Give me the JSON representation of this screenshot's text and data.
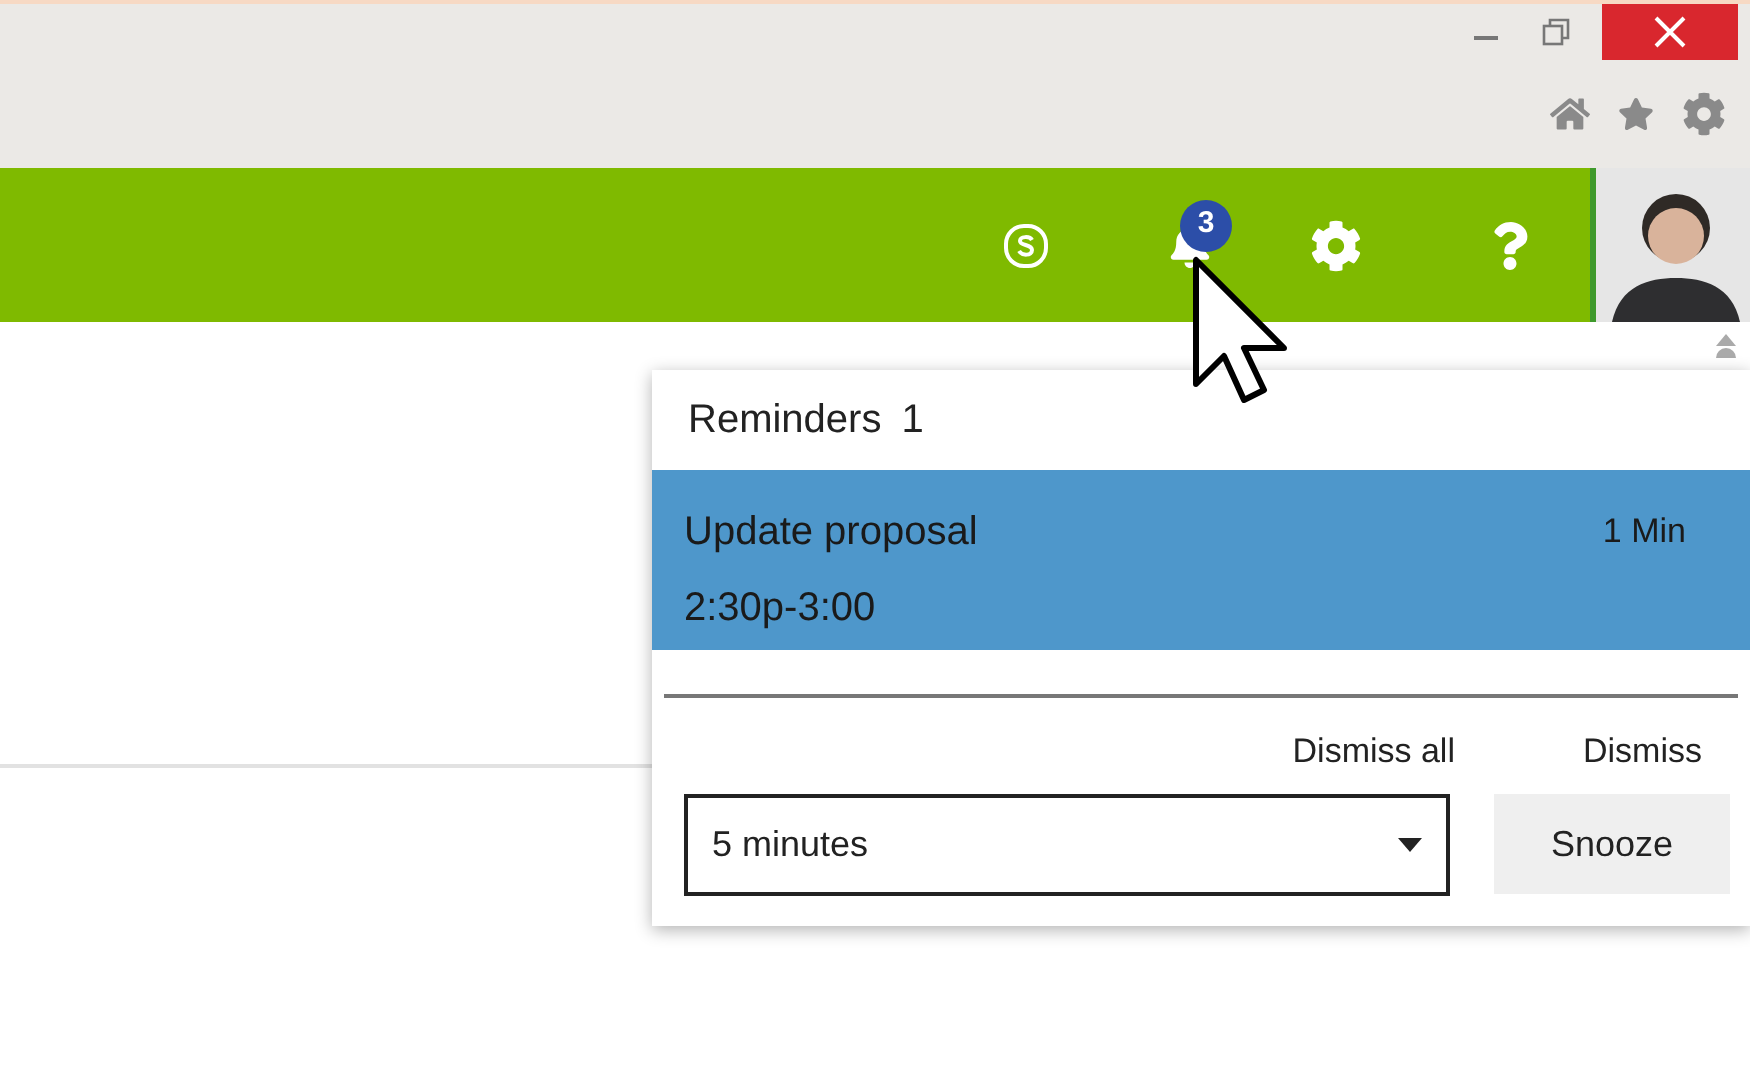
{
  "notifications": {
    "count": "3"
  },
  "reminders": {
    "title": "Reminders",
    "count": "1",
    "items": [
      {
        "title": "Update proposal",
        "time": "2:30p-3:00",
        "due": "1 Min",
        "selected": true
      }
    ],
    "dismiss_all": "Dismiss all",
    "dismiss": "Dismiss",
    "snooze_select": {
      "value": "5 minutes"
    },
    "snooze": "Snooze"
  }
}
